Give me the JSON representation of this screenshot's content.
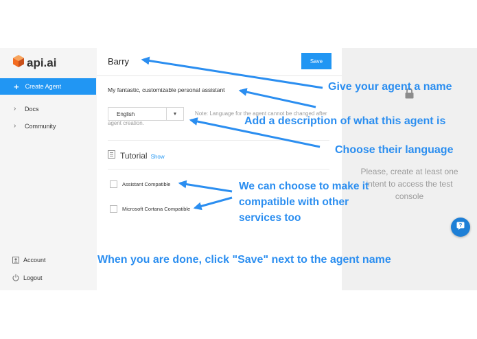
{
  "app": {
    "logo_text": "api.ai"
  },
  "sidebar": {
    "create_agent_label": "Create Agent",
    "items": [
      {
        "label": "Docs"
      },
      {
        "label": "Community"
      }
    ],
    "bottom": [
      {
        "label": "Account"
      },
      {
        "label": "Logout"
      }
    ]
  },
  "agent": {
    "name": "Barry",
    "save_label": "Save",
    "description": "My fantastic, customizable personal assistant",
    "language": "English",
    "language_note": "Note: Language for the agent cannot be changed after agent creation."
  },
  "tutorial": {
    "label": "Tutorial",
    "show_link": "Show"
  },
  "compatibility": [
    {
      "label": "Assistant Compatible",
      "checked": false
    },
    {
      "label": "Microsoft Cortana Compatible",
      "checked": false
    }
  ],
  "console": {
    "message": "Please, create at least one intent to access the test console"
  },
  "annotations": {
    "name": "Give your agent a name",
    "description": "Add a description of what this agent is",
    "language": "Choose their language",
    "compatible_line1": "We can choose to make it",
    "compatible_line2": "compatible with other",
    "compatible_line3": "services too",
    "save": "When you are done, click \"Save\" next to the agent name"
  },
  "colors": {
    "accent": "#2196f3",
    "annotation": "#2b8ef0",
    "logo": "#f36c21"
  },
  "icons": {
    "logo": "api-ai-cube-icon",
    "create": "plus-icon",
    "nav": "chevron-right-icon",
    "account": "user-icon",
    "logout": "power-icon",
    "tutorial": "book-icon",
    "console": "lock-icon",
    "help": "question-icon"
  }
}
